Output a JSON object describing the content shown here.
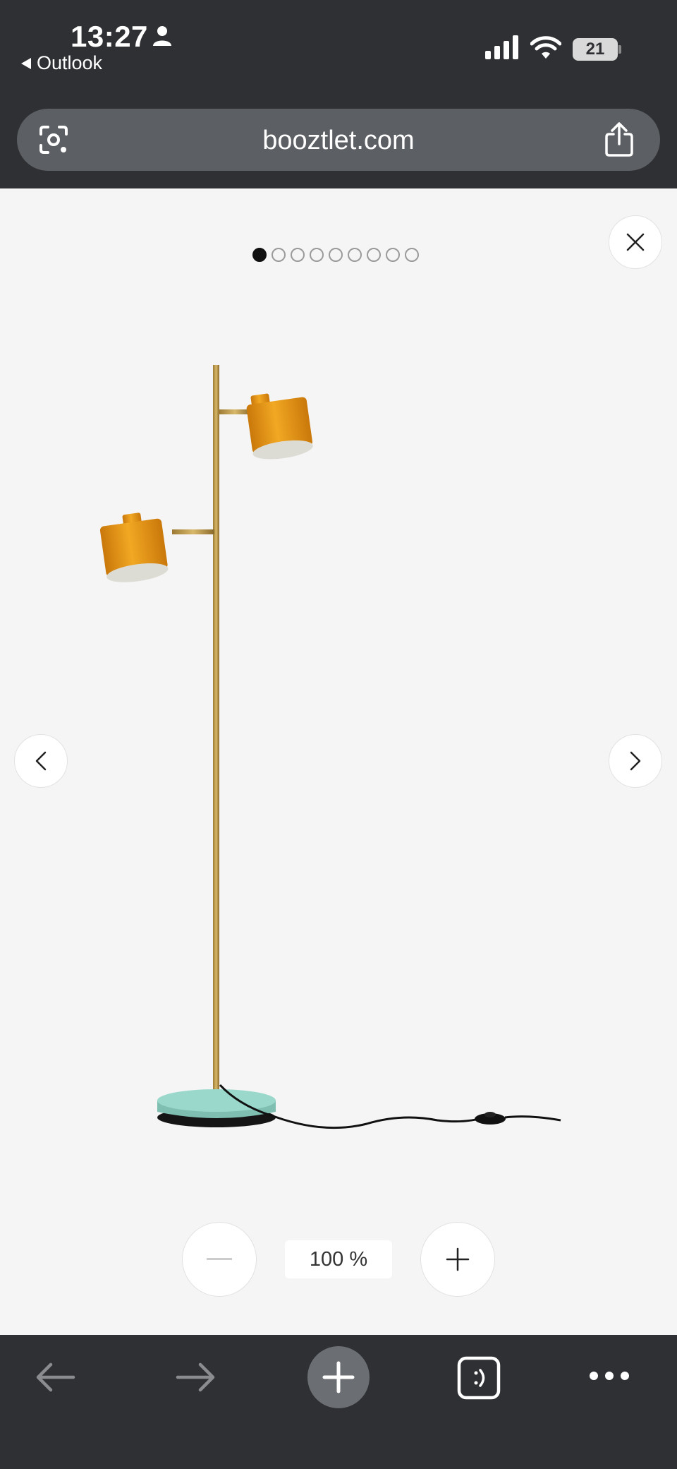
{
  "status_bar": {
    "time": "13:27",
    "back_app": "Outlook",
    "battery": "21"
  },
  "address_bar": {
    "url": "booztlet.com"
  },
  "gallery": {
    "total_images": 9,
    "active_index": 0
  },
  "zoom": {
    "level": "100 %"
  },
  "icons": {
    "lens": "google-lens-icon",
    "share": "share-icon",
    "close": "close-icon",
    "prev": "chevron-left-icon",
    "next": "chevron-right-icon",
    "zoom_out": "minus-icon",
    "zoom_in": "plus-icon",
    "nav_back": "arrow-left-icon",
    "nav_forward": "arrow-right-icon",
    "new_tab": "plus-icon",
    "tabs": "tab-switcher-icon",
    "menu": "more-icon"
  },
  "colors": {
    "chrome": "#2f3033",
    "url_bar": "#5c5f63",
    "viewer_bg": "#f5f5f5",
    "lamp_shade": "#e8950f",
    "lamp_base": "#8fd1c3"
  }
}
